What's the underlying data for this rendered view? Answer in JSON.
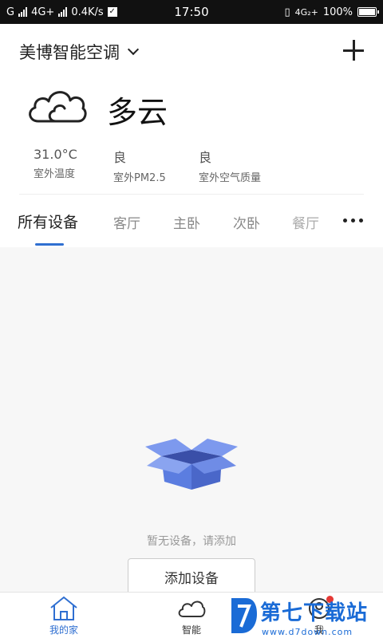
{
  "status_bar": {
    "carrier1": "G",
    "network": "4G+",
    "speed": "0.4K/s",
    "time": "17:50",
    "network2": "4G₂+",
    "battery": "100%",
    "battery_level": 1.0
  },
  "header": {
    "home_title": "美博智能空调",
    "weather": {
      "icon": "cloud-icon",
      "condition": "多云"
    },
    "metrics": [
      {
        "value": "31.0°C",
        "label": "室外温度"
      },
      {
        "value": "良",
        "label": "室外PM2.5"
      },
      {
        "value": "良",
        "label": "室外空气质量"
      }
    ]
  },
  "tabs": [
    {
      "label": "所有设备",
      "active": true
    },
    {
      "label": "客厅",
      "active": false
    },
    {
      "label": "主卧",
      "active": false
    },
    {
      "label": "次卧",
      "active": false
    },
    {
      "label": "餐厅",
      "active": false
    }
  ],
  "empty_state": {
    "icon": "open-box-icon",
    "message": "暂无设备，请添加",
    "button_label": "添加设备"
  },
  "bottom_nav": [
    {
      "label": "我的家",
      "icon": "home-icon",
      "active": true
    },
    {
      "label": "智能",
      "icon": "cloud-icon",
      "active": false
    },
    {
      "label": "我",
      "icon": "profile-icon",
      "active": false,
      "badge": true
    }
  ],
  "watermark": {
    "text": "第七下载站",
    "url": "www.d7down.com"
  },
  "colors": {
    "accent": "#2f6fd1",
    "box": "#5b7de0",
    "badge": "#e53935"
  }
}
